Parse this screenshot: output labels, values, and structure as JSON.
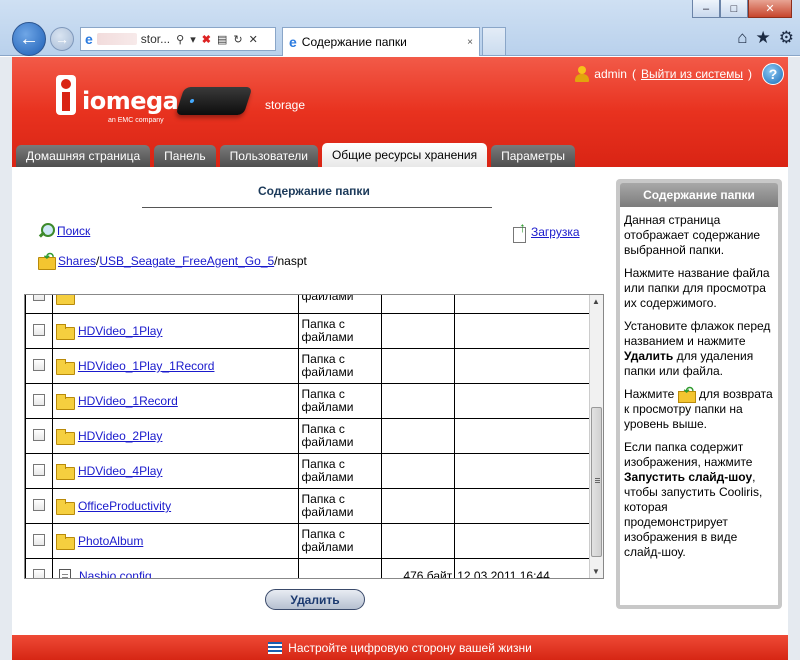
{
  "browser": {
    "address_text": "stor...",
    "tab_title": "Содержание папки",
    "tab_close": "×",
    "win_min": "–",
    "win_max": "□",
    "win_close": "✕",
    "icons": [
      "back-arrow-icon",
      "forward-arrow-icon",
      "ie-logo-icon",
      "search-icon",
      "stop-icon",
      "refresh-icon",
      "home-icon",
      "favorites-star-icon",
      "gear-icon"
    ]
  },
  "header": {
    "brand": "iomega",
    "brand_sub": "an EMC company",
    "device_label": "storage",
    "user_name": "admin",
    "logout_open": "(",
    "logout_label": "Выйти из системы",
    "logout_close": ")",
    "help": "?"
  },
  "nav": {
    "tabs": [
      {
        "label": "Домашняя страница"
      },
      {
        "label": "Панель"
      },
      {
        "label": "Пользователи"
      },
      {
        "label": "Общие ресурсы хранения",
        "active": true
      },
      {
        "label": "Параметры"
      }
    ]
  },
  "main": {
    "title": "Содержание папки",
    "search_label": "Поиск",
    "upload_label": "Загрузка",
    "breadcrumb": {
      "shares": "Shares",
      "sep1": "/",
      "drive": "USB_Seagate_FreeAgent_Go_5",
      "tail": "/naspt"
    },
    "rows": [
      {
        "name": "",
        "type_l1": "",
        "type_l2": "файлами",
        "size": "",
        "date": ""
      },
      {
        "name": "HDVideo_1Play",
        "type_l1": "Папка с",
        "type_l2": "файлами",
        "size": "",
        "date": ""
      },
      {
        "name": "HDVideo_1Play_1Record",
        "type_l1": "Папка с",
        "type_l2": "файлами",
        "size": "",
        "date": ""
      },
      {
        "name": "HDVideo_1Record",
        "type_l1": "Папка с",
        "type_l2": "файлами",
        "size": "",
        "date": ""
      },
      {
        "name": "HDVideo_2Play",
        "type_l1": "Папка с",
        "type_l2": "файлами",
        "size": "",
        "date": ""
      },
      {
        "name": "HDVideo_4Play",
        "type_l1": "Папка с",
        "type_l2": "файлами",
        "size": "",
        "date": ""
      },
      {
        "name": "OfficeProductivity",
        "type_l1": "Папка с",
        "type_l2": "файлами",
        "size": "",
        "date": ""
      },
      {
        "name": "PhotoAlbum",
        "type_l1": "Папка с",
        "type_l2": "файлами",
        "size": "",
        "date": ""
      },
      {
        "name": "Nasbio.config",
        "type_l1": "",
        "type_l2": "",
        "size": "476 байт",
        "date": "12.03.2011 16:44"
      }
    ],
    "delete_label": "Удалить"
  },
  "sidebar": {
    "title": "Содержание папки",
    "p1": "Данная страница отображает содержание выбранной папки.",
    "p2": "Нажмите название файла или папки для просмотра их содержимого.",
    "p3_a": "Установите флажок перед названием и нажмите ",
    "p3_b": "Удалить",
    "p3_c": " для удаления папки или файла.",
    "p4_a": "Нажмите ",
    "p4_b": " для возврата к просмотру папки на уровень выше.",
    "p5_a": "Если папка содержит изображения, нажмите ",
    "p5_b": "Запустить слайд-шоу",
    "p5_c": ", чтобы запустить Cooliris, которая продемонстрирует изображения в виде слайд-шоу."
  },
  "footer": {
    "text": "Настройте цифровую сторону вашей жизни"
  },
  "colors": {
    "header_red": "#e8321f",
    "link_blue": "#1a1acc",
    "tab_gray": "#5e5e5e",
    "sidebar_gray": "#c8c8c8"
  }
}
